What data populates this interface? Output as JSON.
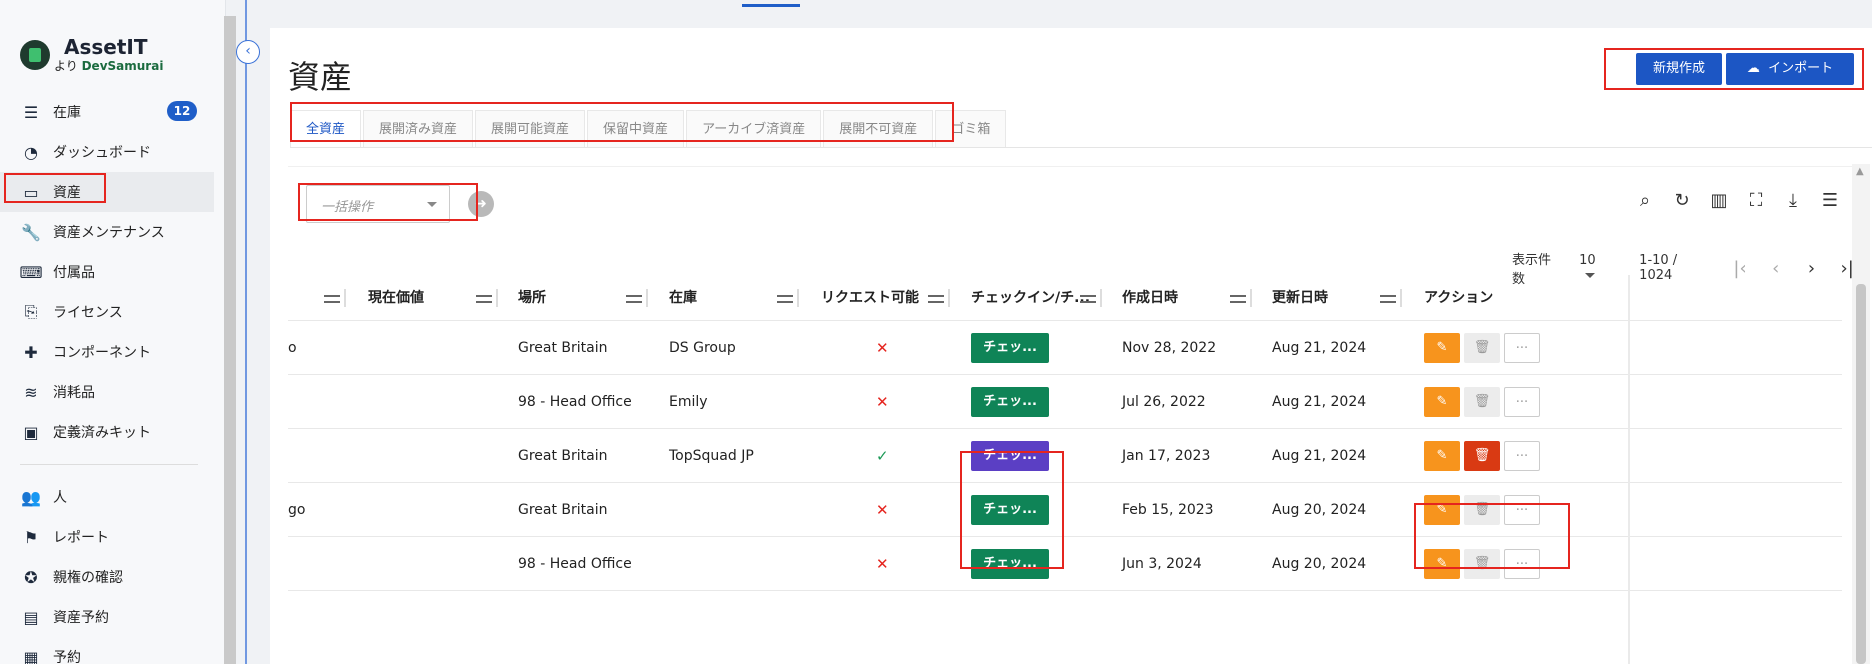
{
  "brand": {
    "name": "AssetIT",
    "sub_prefix": "より",
    "sub_company": "DevSamurai"
  },
  "sidebar": {
    "items": [
      {
        "label": "在庫",
        "icon": "sliders-icon",
        "badge": "12"
      },
      {
        "label": "ダッシュボード",
        "icon": "gauge-icon"
      },
      {
        "label": "資産",
        "icon": "laptop-icon",
        "active": true
      },
      {
        "label": "資産メンテナンス",
        "icon": "wrench-icon"
      },
      {
        "label": "付属品",
        "icon": "keyboard-icon"
      },
      {
        "label": "ライセンス",
        "icon": "license-icon"
      },
      {
        "label": "コンポーネント",
        "icon": "puzzle-icon"
      },
      {
        "label": "消耗品",
        "icon": "layers-icon"
      },
      {
        "label": "定義済みキット",
        "icon": "toolbox-icon"
      }
    ],
    "items2": [
      {
        "label": "人",
        "icon": "users-icon"
      },
      {
        "label": "レポート",
        "icon": "flag-icon"
      },
      {
        "label": "親権の確認",
        "icon": "badge-check-icon"
      },
      {
        "label": "資産予約",
        "icon": "reservation-icon"
      },
      {
        "label": "予約",
        "icon": "calendar-icon"
      }
    ]
  },
  "page": {
    "title": "資産",
    "new_button": "新規作成",
    "import_button": "インポート"
  },
  "tabs": [
    "全資産",
    "展開済み資産",
    "展開可能資産",
    "保留中資産",
    "アーカイブ済資産",
    "展開不可資産",
    "ゴミ箱"
  ],
  "toolbar": {
    "bulk_placeholder": "一括操作",
    "page_size_label": "表示件数",
    "page_size": "10",
    "range": "1-10 / 1024"
  },
  "table": {
    "columns": [
      "現在価値",
      "場所",
      "在庫",
      "リクエスト可能",
      "チェックイン/チ...",
      "作成日時",
      "更新日時",
      "アクション"
    ],
    "rows": [
      {
        "first": "o",
        "value": "",
        "location": "Great Britain",
        "stock": "DS Group",
        "requestable": "✕",
        "check": "チェッ...",
        "check_color": "green",
        "created": "Nov 28, 2022",
        "updated": "Aug 21, 2024",
        "delete_active": false
      },
      {
        "first": "",
        "value": "",
        "location": "98 - Head Office",
        "stock": "Emily",
        "requestable": "✕",
        "check": "チェッ...",
        "check_color": "green",
        "created": "Jul 26, 2022",
        "updated": "Aug 21, 2024",
        "delete_active": false
      },
      {
        "first": "",
        "value": "",
        "location": "Great Britain",
        "stock": "TopSquad JP",
        "requestable": "✓",
        "check": "チェッ...",
        "check_color": "purple",
        "created": "Jan 17, 2023",
        "updated": "Aug 21, 2024",
        "delete_active": true
      },
      {
        "first": "go",
        "value": "",
        "location": "Great Britain",
        "stock": "",
        "requestable": "✕",
        "check": "チェッ...",
        "check_color": "green",
        "created": "Feb 15, 2023",
        "updated": "Aug 20, 2024",
        "delete_active": false
      },
      {
        "first": "",
        "value": "",
        "location": "98 - Head Office",
        "stock": "",
        "requestable": "✕",
        "check": "チェッ...",
        "check_color": "green",
        "created": "Jun 3, 2024",
        "updated": "Aug 20, 2024",
        "delete_active": false
      }
    ]
  },
  "colors": {
    "primary": "#1c56c4",
    "edit": "#f7941d",
    "delete": "#d93a13",
    "checkin_green": "#0f8457",
    "checkin_purple": "#5b3fc4",
    "annotation": "#e5251f"
  }
}
